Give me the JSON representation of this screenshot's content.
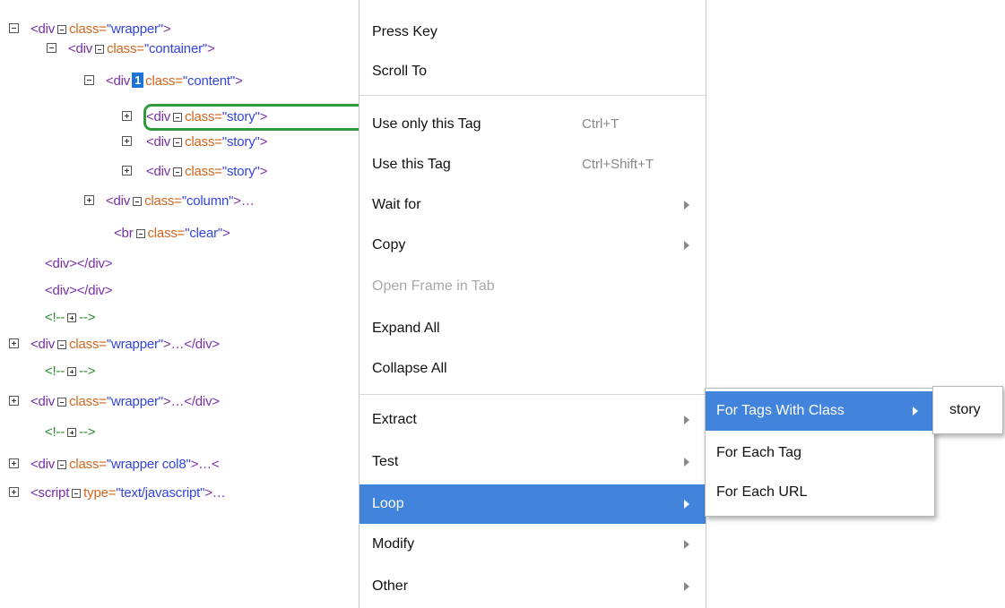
{
  "tree": {
    "r1": {
      "tag": "<div",
      "attr": "class=",
      "val": "\"wrapper\"",
      "end": ">"
    },
    "r2": {
      "tag": "<div",
      "attr": "class=",
      "val": "\"container\"",
      "end": ">"
    },
    "r3": {
      "tag": "<div",
      "badge": "1",
      "attr": "class=",
      "val": "\"content\"",
      "end": ">"
    },
    "r4": {
      "tag": "<div",
      "attr": "class=",
      "val": "\"story\"",
      "end": ">"
    },
    "r5": {
      "tag": "<div",
      "attr": "class=",
      "val": "\"story\"",
      "end": ">"
    },
    "r6": {
      "tag": "<div",
      "attr": "class=",
      "val": "\"story\"",
      "end": ">"
    },
    "r7": {
      "tag": "<div",
      "attr": "class=",
      "val": "\"column\"",
      "end": ">…"
    },
    "r8": {
      "tag": "<br",
      "attr": "class=",
      "val": "\"clear\"",
      "end": ">"
    },
    "r9": {
      "text": "<div></div>"
    },
    "r10": {
      "text": "<div></div>"
    },
    "r11": {
      "open": "<!--",
      "close": "-->"
    },
    "r12": {
      "tag": "<div",
      "attr": "class=",
      "val": "\"wrapper\"",
      "end": ">…</div>"
    },
    "r13": {
      "open": "<!--",
      "close": "-->"
    },
    "r14": {
      "tag": "<div",
      "attr": "class=",
      "val": "\"wrapper\"",
      "end": ">…</div>"
    },
    "r15": {
      "open": "<!--",
      "close": "-->"
    },
    "r16": {
      "tag": "<div",
      "attr": "class=",
      "val": "\"wrapper col8\"",
      "end": ">…<"
    },
    "r17": {
      "tag": "<script",
      "attr": "type=",
      "val": "\"text/javascript\"",
      "end": ">…"
    }
  },
  "menu": {
    "press_key": "Press Key",
    "scroll_to": "Scroll To",
    "use_only_tag": "Use only this Tag",
    "use_only_tag_shortcut": "Ctrl+T",
    "use_tag": "Use this Tag",
    "use_tag_shortcut": "Ctrl+Shift+T",
    "wait_for": "Wait for",
    "copy": "Copy",
    "open_frame": "Open Frame in Tab",
    "expand_all": "Expand All",
    "collapse_all": "Collapse All",
    "extract": "Extract",
    "test": "Test",
    "loop": "Loop",
    "modify": "Modify",
    "other": "Other"
  },
  "loop_submenu": {
    "tags_with_class": "For Tags With Class",
    "each_tag": "For Each Tag",
    "each_url": "For Each URL"
  },
  "class_submenu": {
    "story": "story"
  },
  "colors": {
    "highlight": "#4284dc",
    "selection_outline": "#2e9a3c"
  }
}
